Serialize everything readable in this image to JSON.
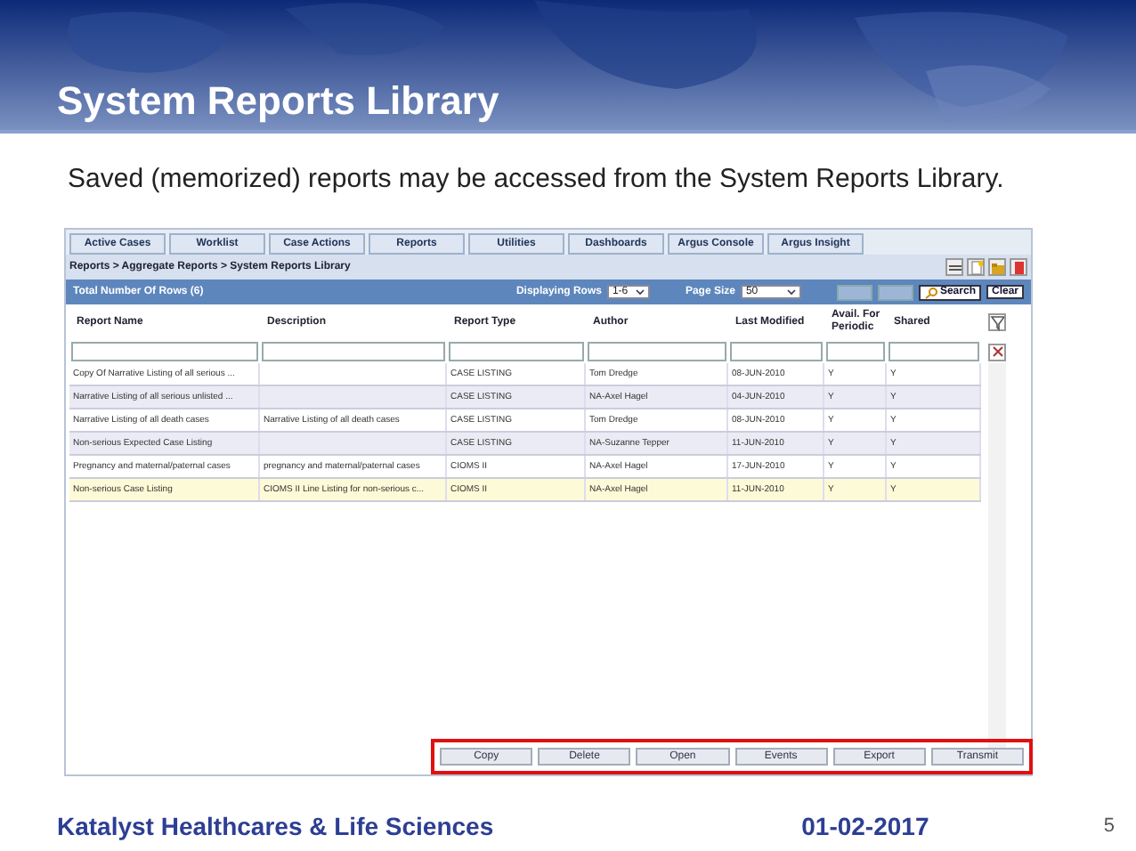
{
  "slide": {
    "title": "System Reports Library",
    "subtitle": "Saved (memorized) reports may be accessed from the System Reports Library."
  },
  "app": {
    "tabs": [
      "Active Cases",
      "Worklist",
      "Case Actions",
      "Reports",
      "Utilities",
      "Dashboards",
      "Argus Console",
      "Argus Insight"
    ],
    "breadcrumb": "Reports > Aggregate Reports > System Reports Library",
    "bar": {
      "total": "Total Number Of Rows (6)",
      "displaying_label": "Displaying Rows",
      "displaying_value": "1-6",
      "page_size_label": "Page Size",
      "page_size_value": "50",
      "search": "Search",
      "clear": "Clear"
    },
    "table": {
      "columns": [
        "Report Name",
        "Description",
        "Report Type",
        "Author",
        "Last Modified",
        "Avail. For Periodic",
        "Shared"
      ],
      "rows": [
        {
          "cells": [
            "Copy Of Narrative Listing of all serious ...",
            "",
            "CASE LISTING",
            "Tom Dredge",
            "08-JUN-2010",
            "Y",
            "Y"
          ],
          "selected": false
        },
        {
          "cells": [
            "Narrative Listing of all serious unlisted ...",
            "",
            "CASE LISTING",
            "NA-Axel Hagel",
            "04-JUN-2010",
            "Y",
            "Y"
          ],
          "selected": false
        },
        {
          "cells": [
            "Narrative Listing of all death cases",
            "Narrative Listing of all death cases",
            "CASE LISTING",
            "Tom Dredge",
            "08-JUN-2010",
            "Y",
            "Y"
          ],
          "selected": false
        },
        {
          "cells": [
            "Non-serious Expected Case Listing",
            "",
            "CASE LISTING",
            "NA-Suzanne Tepper",
            "11-JUN-2010",
            "Y",
            "Y"
          ],
          "selected": false
        },
        {
          "cells": [
            "Pregnancy and maternal/paternal cases",
            "pregnancy and maternal/paternal cases",
            "CIOMS II",
            "NA-Axel Hagel",
            "17-JUN-2010",
            "Y",
            "Y"
          ],
          "selected": false
        },
        {
          "cells": [
            "Non-serious Case Listing",
            "CIOMS II Line Listing for non-serious c...",
            "CIOMS II",
            "NA-Axel Hagel",
            "11-JUN-2010",
            "Y",
            "Y"
          ],
          "selected": true
        }
      ]
    },
    "buttons": [
      "Copy",
      "Delete",
      "Open",
      "Events",
      "Export",
      "Transmit"
    ]
  },
  "footer": {
    "company": "Katalyst Healthcares & Life Sciences",
    "date": "01-02-2017",
    "page": "5"
  }
}
